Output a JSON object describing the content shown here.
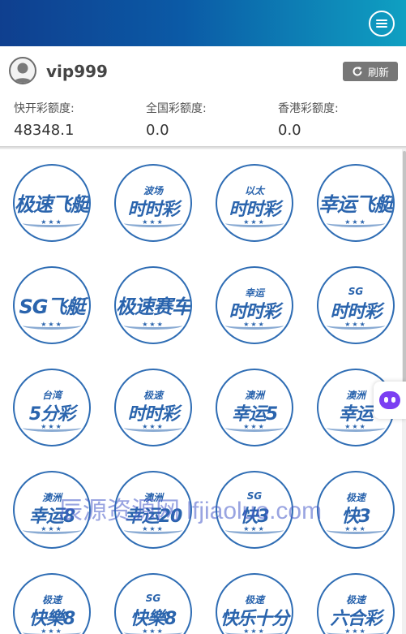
{
  "header": {
    "menu_icon": "menu-icon",
    "gradient": [
      "#0f3f8f",
      "#0fa0c2"
    ]
  },
  "user": {
    "name": "vip999",
    "refresh_label": "刷新"
  },
  "balances": [
    {
      "label": "快开彩额度:",
      "value": "48348.1"
    },
    {
      "label": "全国彩额度:",
      "value": "0.0"
    },
    {
      "label": "香港彩额度:",
      "value": "0.0"
    }
  ],
  "games": [
    {
      "top": "",
      "main": "极速飞艇"
    },
    {
      "top": "波场",
      "main": "时时彩"
    },
    {
      "top": "以太",
      "main": "时时彩"
    },
    {
      "top": "",
      "main": "幸运飞艇"
    },
    {
      "top": "",
      "main": "SG飞艇"
    },
    {
      "top": "",
      "main": "极速赛车"
    },
    {
      "top": "幸运",
      "main": "时时彩"
    },
    {
      "top": "SG",
      "main": "时时彩"
    },
    {
      "top": "台湾",
      "main": "5分彩"
    },
    {
      "top": "极速",
      "main": "时时彩"
    },
    {
      "top": "澳洲",
      "main": "幸运5"
    },
    {
      "top": "澳洲",
      "main": "幸运"
    },
    {
      "top": "澳洲",
      "main": "幸运8"
    },
    {
      "top": "澳洲",
      "main": "幸运20"
    },
    {
      "top": "SG",
      "main": "快3"
    },
    {
      "top": "极速",
      "main": "快3"
    },
    {
      "top": "极速",
      "main": "快樂8"
    },
    {
      "top": "SG",
      "main": "快樂8"
    },
    {
      "top": "极速",
      "main": "快乐十分"
    },
    {
      "top": "极速",
      "main": "六合彩"
    }
  ],
  "watermark": "辰源资源网 lfjiaoluo.com",
  "colors": {
    "accent": "#2a64ad",
    "refresh_bg": "#777777"
  }
}
